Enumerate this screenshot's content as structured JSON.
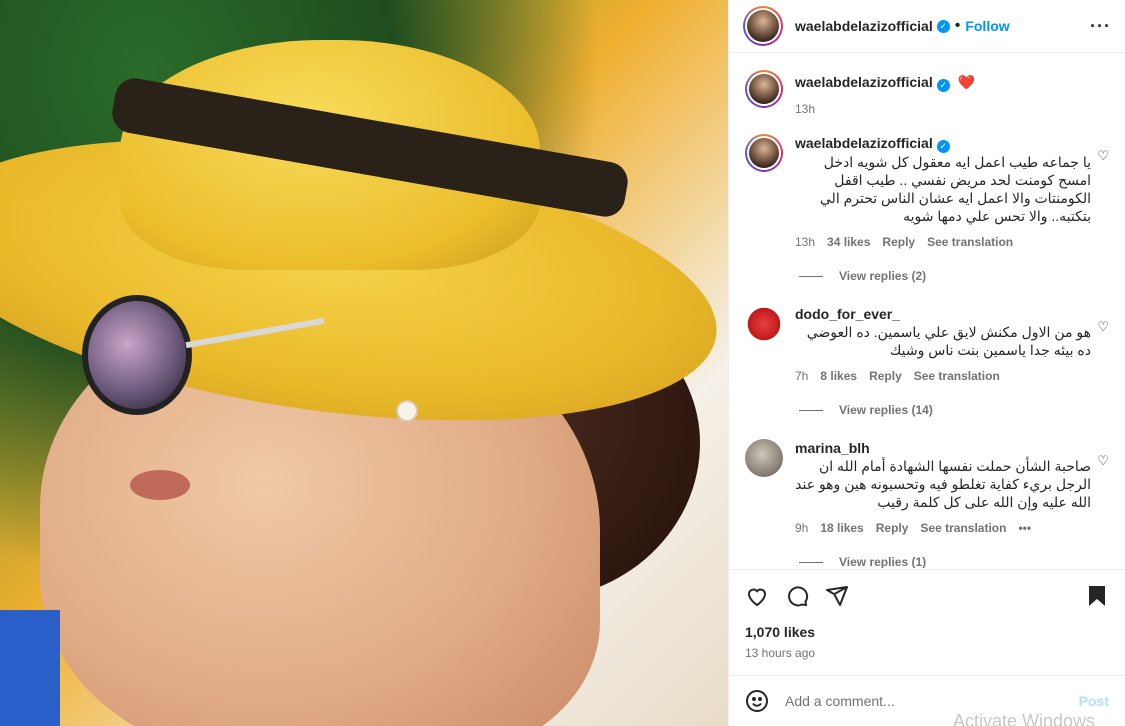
{
  "post": {
    "username": "waelabdelazizofficial",
    "follow_label": "Follow",
    "separator": "•",
    "more_label": "···"
  },
  "caption": {
    "username": "waelabdelazizofficial",
    "text": "❤️",
    "time": "13h"
  },
  "comments": [
    {
      "username": "waelabdelazizofficial",
      "text": "يا جماعه طيب اعمل ايه معقول كل شويه ادخل امسح كومنت لحد مريض نفسي .. طيب اقفل الكومنتات والا اعمل ايه عشان الناس تحترم الي بتكتبه.. والا تحس علي دمها شويه",
      "time": "13h",
      "likes": "34 likes",
      "reply": "Reply",
      "translate": "See translation",
      "view_replies": "View replies (2)"
    },
    {
      "username": "dodo_for_ever_",
      "text": "هو من الاول مكنش لايق علي ياسمين. ده العوضي ده بيئه جدا ياسمين بنت ناس وشيك",
      "time": "7h",
      "likes": "8 likes",
      "reply": "Reply",
      "translate": "See translation",
      "view_replies": "View replies (14)"
    },
    {
      "username": "marina_blh",
      "text": "صاحبة الشأن حملت نفسها الشهادة أمام الله ان الرجل بريء كفاية تغلطو فيه وتحسبونه هين وهو عند الله عليه وإن الله على كل كلمة رقيب",
      "time": "9h",
      "likes": "18 likes",
      "reply": "Reply",
      "translate": "See translation",
      "more": "•••",
      "view_replies": "View replies (1)"
    }
  ],
  "footer": {
    "likes": "1,070 likes",
    "ago": "13 hours ago",
    "comment_placeholder": "Add a comment...",
    "post_label": "Post",
    "watermark": "Activate Windows"
  },
  "colors": {
    "accent": "#0095f6",
    "muted": "#737373",
    "post_disabled": "#b2dffc"
  }
}
